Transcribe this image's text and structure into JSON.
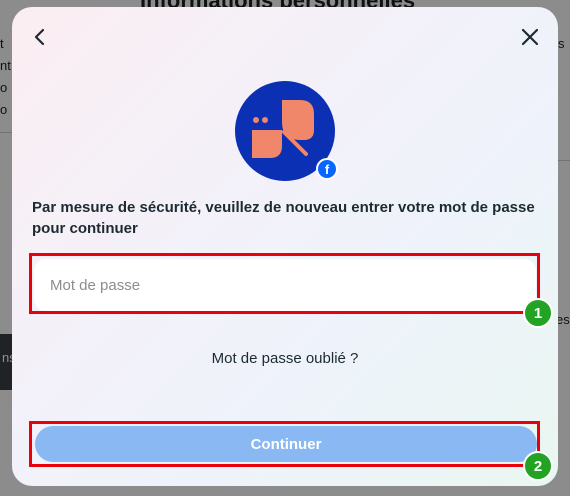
{
  "background": {
    "title": "Informations personnelles",
    "fragments": [
      "t",
      "nt",
      "o",
      "o",
      "s",
      "es",
      "ns"
    ]
  },
  "modal": {
    "back_icon": "chevron-left-icon",
    "close_icon": "close-icon",
    "avatar_icon": "profile-avatar-icon",
    "badge_icon": "facebook-icon",
    "badge_letter": "f",
    "instruction": "Par mesure de sécurité, veuillez de nouveau entrer votre mot de passe pour continuer",
    "password": {
      "placeholder": "Mot de passe",
      "value": ""
    },
    "forgot_link": "Mot de passe oublié ?",
    "continue_label": "Continuer"
  },
  "annotations": [
    {
      "label": "1"
    },
    {
      "label": "2"
    }
  ],
  "colors": {
    "annotation_border": "#e8000b",
    "annotation_badge": "#23a323",
    "button_disabled": "#8ab8f3",
    "avatar_bg": "#0c30b4",
    "avatar_shape": "#f0876a"
  }
}
